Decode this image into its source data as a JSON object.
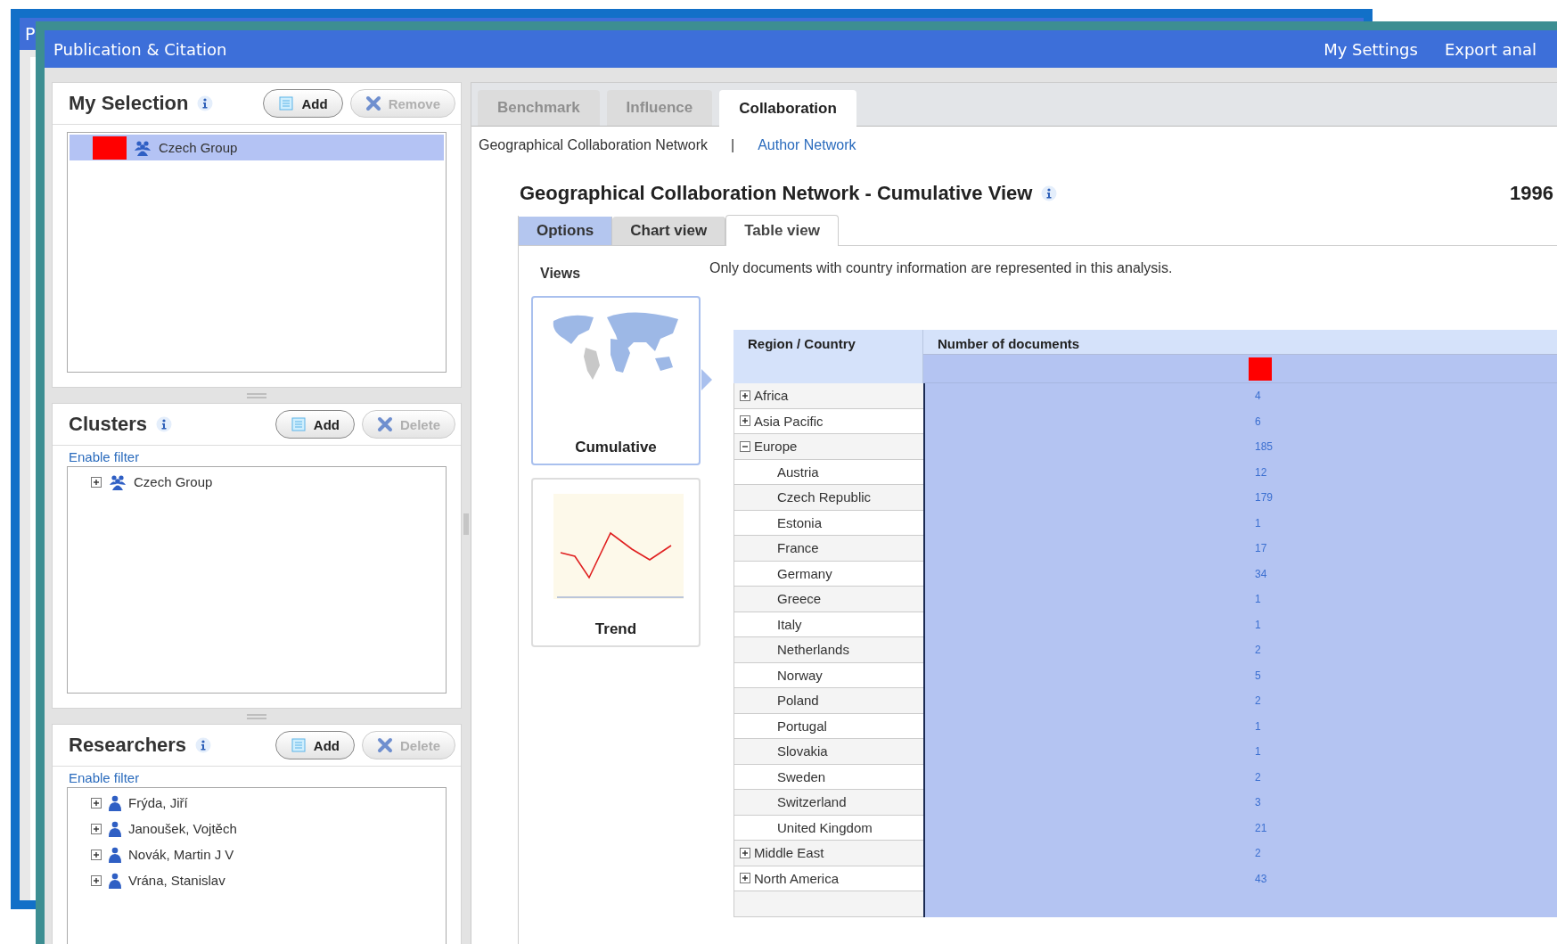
{
  "background_window": {
    "title": "P"
  },
  "window": {
    "title": "Publication & Citation",
    "menu": [
      "My Settings",
      "Export anal"
    ]
  },
  "panels": [
    {
      "title": "My Selection",
      "buttons": [
        {
          "label": "Add",
          "kind": "add",
          "disabled": false
        },
        {
          "label": "Remove",
          "kind": "remove",
          "disabled": true
        }
      ],
      "items": [
        {
          "label": "Czech Group",
          "kind": "group",
          "color": "#ff0000",
          "selected": true
        }
      ]
    },
    {
      "title": "Clusters",
      "buttons": [
        {
          "label": "Add",
          "kind": "add",
          "disabled": false
        },
        {
          "label": "Delete",
          "kind": "remove",
          "disabled": true
        }
      ],
      "filter_link": "Enable filter",
      "items": [
        {
          "label": "Czech Group",
          "kind": "group",
          "expanded": false,
          "selected": false
        }
      ]
    },
    {
      "title": "Researchers",
      "buttons": [
        {
          "label": "Add",
          "kind": "add",
          "disabled": false
        },
        {
          "label": "Delete",
          "kind": "remove",
          "disabled": true
        }
      ],
      "filter_link": "Enable filter",
      "items": [
        {
          "label": "Frýda, Jiří",
          "kind": "person",
          "expanded": false,
          "selected": false
        },
        {
          "label": "Janoušek, Vojtěch",
          "kind": "person",
          "expanded": false,
          "selected": false
        },
        {
          "label": "Novák, Martin J V",
          "kind": "person",
          "expanded": false,
          "selected": false
        },
        {
          "label": "Vrána, Stanislav",
          "kind": "person",
          "expanded": false,
          "selected": false
        }
      ]
    }
  ],
  "tabs": [
    {
      "label": "Benchmark",
      "selected": false,
      "disabled": true
    },
    {
      "label": "Influence",
      "selected": false,
      "disabled": true
    },
    {
      "label": "Collaboration",
      "selected": true,
      "disabled": false
    }
  ],
  "subnav": {
    "items": [
      {
        "label": "Geographical Collaboration Network",
        "selected": true
      },
      {
        "label": "Author Network",
        "selected": false
      }
    ],
    "separator": "|"
  },
  "heading": "Geographical Collaboration Network - Cumulative View",
  "period": "1996",
  "view_tabs": [
    {
      "label": "Options",
      "kind": "options",
      "selected": false
    },
    {
      "label": "Chart view",
      "kind": "tab",
      "selected": false
    },
    {
      "label": "Table view",
      "kind": "tab",
      "selected": true
    }
  ],
  "views": {
    "title": "Views",
    "items": [
      {
        "label": "Cumulative",
        "kind": "map",
        "selected": true
      },
      {
        "label": "Trend",
        "kind": "trend",
        "selected": false
      }
    ]
  },
  "note": "Only documents with country information are represented in this analysis.",
  "table": {
    "columns": [
      "Region / Country",
      "Number of documents"
    ],
    "legend": [
      {
        "color": "#ff0000"
      }
    ],
    "rows": [
      {
        "name": "Africa",
        "value": "4",
        "expanded": false
      },
      {
        "name": "Asia Pacific",
        "value": "6",
        "expanded": false
      },
      {
        "name": "Europe",
        "value": "185",
        "expanded": true,
        "children": [
          {
            "name": "Austria",
            "value": "12"
          },
          {
            "name": "Czech Republic",
            "value": "179"
          },
          {
            "name": "Estonia",
            "value": "1"
          },
          {
            "name": "France",
            "value": "17"
          },
          {
            "name": "Germany",
            "value": "34"
          },
          {
            "name": "Greece",
            "value": "1"
          },
          {
            "name": "Italy",
            "value": "1"
          },
          {
            "name": "Netherlands",
            "value": "2"
          },
          {
            "name": "Norway",
            "value": "5"
          },
          {
            "name": "Poland",
            "value": "2"
          },
          {
            "name": "Portugal",
            "value": "1"
          },
          {
            "name": "Slovakia",
            "value": "1"
          },
          {
            "name": "Sweden",
            "value": "2"
          },
          {
            "name": "Switzerland",
            "value": "3"
          },
          {
            "name": "United Kingdom",
            "value": "21"
          }
        ]
      },
      {
        "name": "Middle East",
        "value": "2",
        "expanded": false
      },
      {
        "name": "North America",
        "value": "43",
        "expanded": false
      }
    ]
  }
}
